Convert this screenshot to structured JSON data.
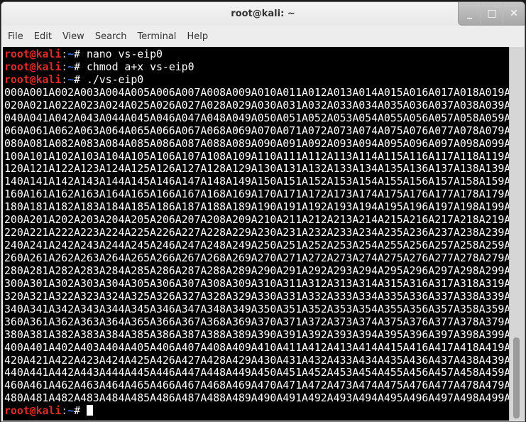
{
  "window": {
    "title": "root@kali: ~",
    "controls": [
      {
        "name": "minimize-button",
        "glyph": "_"
      },
      {
        "name": "maximize-button",
        "glyph": "□"
      },
      {
        "name": "close-button",
        "glyph": "✕"
      }
    ]
  },
  "menubar": {
    "items": [
      "File",
      "Edit",
      "View",
      "Search",
      "Terminal",
      "Help"
    ]
  },
  "terminal": {
    "prompt": {
      "user_host": "root@kali",
      "colon": ":",
      "path": "~",
      "symbol": "# "
    },
    "colors": {
      "prompt_user": "#e02a2a",
      "prompt_path": "#3b6ee3",
      "text": "#ffffff",
      "background": "#000000"
    },
    "commands": [
      "nano vs-eip0",
      "chmod a+x vs-eip0",
      "./vs-eip0"
    ],
    "output_lines": [
      "000A001A002A003A004A005A006A007A008A009A010A011A012A013A014A015A016A017A018A019A",
      "020A021A022A023A024A025A026A027A028A029A030A031A032A033A034A035A036A037A038A039A",
      "040A041A042A043A044A045A046A047A048A049A050A051A052A053A054A055A056A057A058A059A",
      "060A061A062A063A064A065A066A067A068A069A070A071A072A073A074A075A076A077A078A079A",
      "080A081A082A083A084A085A086A087A088A089A090A091A092A093A094A095A096A097A098A099A",
      "100A101A102A103A104A105A106A107A108A109A110A111A112A113A114A115A116A117A118A119A",
      "120A121A122A123A124A125A126A127A128A129A130A131A132A133A134A135A136A137A138A139A",
      "140A141A142A143A144A145A146A147A148A149A150A151A152A153A154A155A156A157A158A159A",
      "160A161A162A163A164A165A166A167A168A169A170A171A172A173A174A175A176A177A178A179A",
      "180A181A182A183A184A185A186A187A188A189A190A191A192A193A194A195A196A197A198A199A",
      "200A201A202A203A204A205A206A207A208A209A210A211A212A213A214A215A216A217A218A219A",
      "220A221A222A223A224A225A226A227A228A229A230A231A232A233A234A235A236A237A238A239A",
      "240A241A242A243A244A245A246A247A248A249A250A251A252A253A254A255A256A257A258A259A",
      "260A261A262A263A264A265A266A267A268A269A270A271A272A273A274A275A276A277A278A279A",
      "280A281A282A283A284A285A286A287A288A289A290A291A292A293A294A295A296A297A298A299A",
      "300A301A302A303A304A305A306A307A308A309A310A311A312A313A314A315A316A317A318A319A",
      "320A321A322A323A324A325A326A327A328A329A330A331A332A333A334A335A336A337A338A339A",
      "340A341A342A343A344A345A346A347A348A349A350A351A352A353A354A355A356A357A358A359A",
      "360A361A362A363A364A365A366A367A368A369A370A371A372A373A374A375A376A377A378A379A",
      "380A381A382A383A384A385A386A387A388A389A390A391A392A393A394A395A396A397A398A399A",
      "400A401A402A403A404A405A406A407A408A409A410A411A412A413A414A415A416A417A418A419A",
      "420A421A422A423A424A425A426A427A428A429A430A431A432A433A434A435A436A437A438A439A",
      "440A441A442A443A444A445A446A447A448A449A450A451A452A453A454A455A456A457A458A459A",
      "460A461A462A463A464A465A466A467A468A469A470A471A472A473A474A475A476A477A478A479A",
      "480A481A482A483A484A485A486A487A488A489A490A491A492A493A494A495A496A497A498A499A"
    ],
    "current_input": ""
  },
  "scrollbar": {
    "position_fraction": 1.0,
    "visible_fraction": 0.22
  }
}
